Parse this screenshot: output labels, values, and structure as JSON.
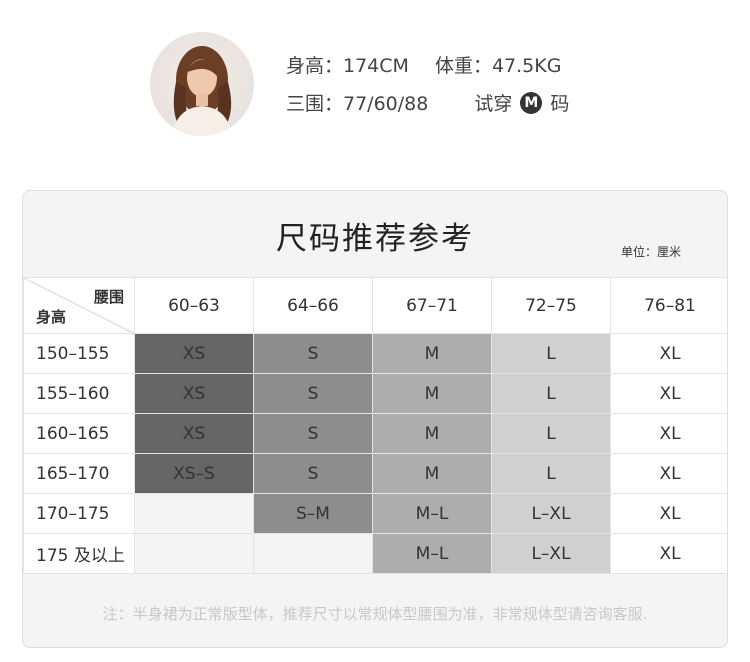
{
  "model": {
    "height_label": "身高：174CM",
    "weight_label": "体重：47.5KG",
    "measurements_label": "三围：77/60/88",
    "try_on_prefix": "试穿",
    "try_on_size": "M",
    "try_on_suffix": "码"
  },
  "chart": {
    "title": "尺码推荐参考",
    "unit": "单位：厘米",
    "corner_top": "腰围",
    "corner_bottom": "身高",
    "columns": [
      "60–63",
      "64–66",
      "67–71",
      "72–75",
      "76–81"
    ],
    "rows": [
      {
        "label": "150–155",
        "cells": [
          "XS",
          "S",
          "M",
          "L",
          "XL"
        ]
      },
      {
        "label": "155–160",
        "cells": [
          "XS",
          "S",
          "M",
          "L",
          "XL"
        ]
      },
      {
        "label": "160–165",
        "cells": [
          "XS",
          "S",
          "M",
          "L",
          "XL"
        ]
      },
      {
        "label": "165–170",
        "cells": [
          "XS–S",
          "S",
          "M",
          "L",
          "XL"
        ]
      },
      {
        "label": "170–175",
        "cells": [
          "",
          "S–M",
          "M–L",
          "L–XL",
          "XL"
        ]
      },
      {
        "label": "175 及以上",
        "cells": [
          "",
          "",
          "M–L",
          "L–XL",
          "XL"
        ]
      }
    ],
    "note": "注：半身裙为正常版型体，推荐尺寸以常规体型腰围为准，非常规体型请咨询客服."
  },
  "colors": {
    "xs": "#656565",
    "s": "#8d8d8d",
    "m": "#adadad",
    "l": "#d0d0d0",
    "xl": "#ffffff",
    "empty": "#f4f4f4"
  }
}
